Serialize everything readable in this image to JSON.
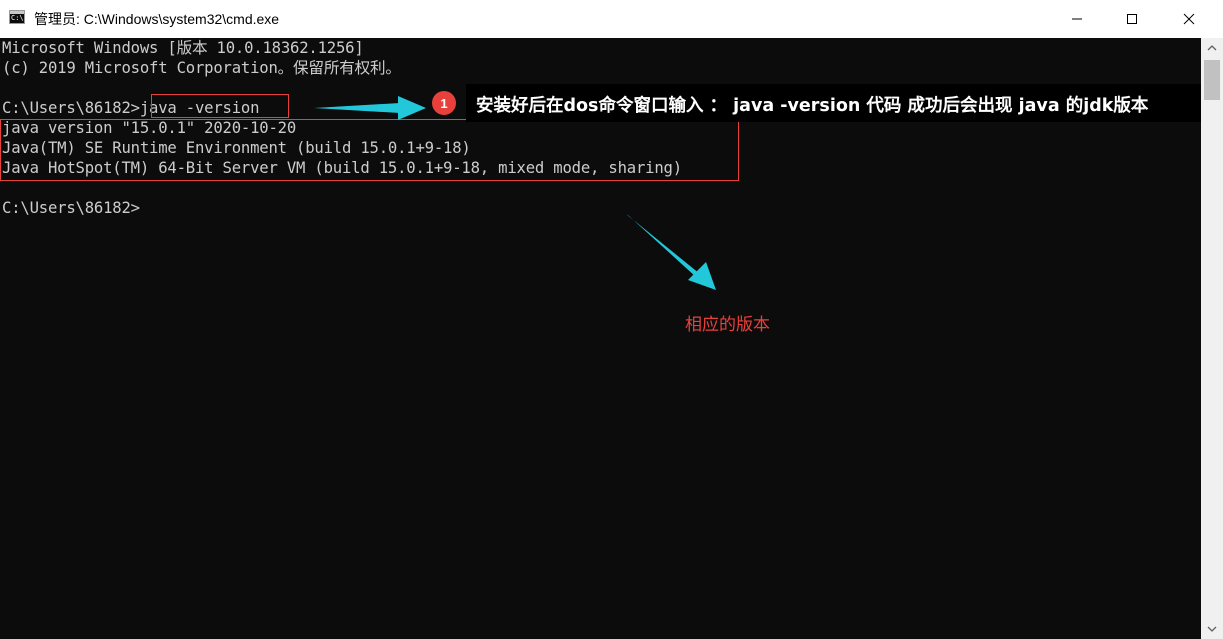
{
  "window": {
    "title": "管理员: C:\\Windows\\system32\\cmd.exe",
    "icon_text": "C:\\",
    "controls": {
      "minimize": "minimize-icon",
      "maximize": "maximize-icon",
      "close": "close-icon"
    }
  },
  "console": {
    "lines": [
      "Microsoft Windows [版本 10.0.18362.1256]",
      "(c) 2019 Microsoft Corporation。保留所有权利。",
      "",
      "C:\\Users\\86182>java -version",
      "java version \"15.0.1\" 2020-10-20",
      "Java(TM) SE Runtime Environment (build 15.0.1+9-18)",
      "Java HotSpot(TM) 64-Bit Server VM (build 15.0.1+9-18, mixed mode, sharing)",
      "",
      "C:\\Users\\86182>"
    ],
    "colors": {
      "background": "#0c0c0c",
      "text": "#cccccc"
    }
  },
  "annotations": {
    "badge_number": "1",
    "instruction": "安装好后在dos命令窗口输入 ： java -version 代码  成功后会出现 java 的jdk版本",
    "version_label": "相应的版本",
    "colors": {
      "highlight": "#e8413c",
      "arrow": "#22c7d9"
    }
  }
}
